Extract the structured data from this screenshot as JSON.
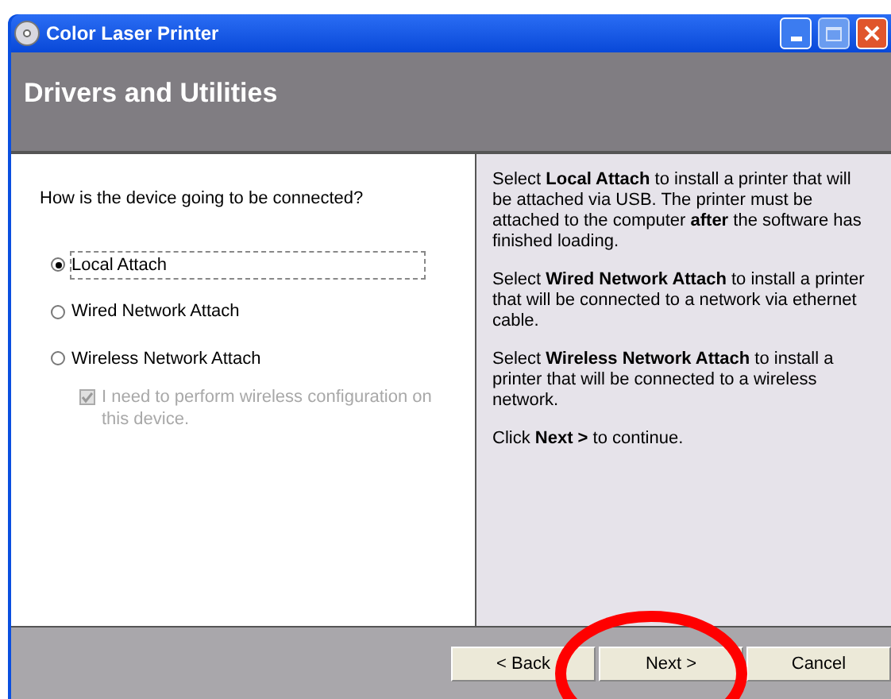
{
  "window": {
    "title": "Color Laser Printer"
  },
  "header": {
    "title": "Drivers and Utilities"
  },
  "question": "How is the device going to be connected?",
  "options": [
    {
      "label": "Local Attach",
      "selected": true,
      "focused": true
    },
    {
      "label": "Wired Network Attach",
      "selected": false,
      "focused": false
    },
    {
      "label": "Wireless Network Attach",
      "selected": false,
      "focused": false
    }
  ],
  "wireless_config": {
    "label": "I need to perform wireless configuration on this device.",
    "checked": true,
    "disabled": true
  },
  "help": [
    "Select **Local Attach** to install a printer that will be attached via USB. The printer must be attached to the computer **after** the software has finished loading.",
    "Select **Wired Network Attach** to install a printer that will be connected to a network via ethernet cable.",
    "Select **Wireless Network Attach** to install a printer that will be connected to a wireless network.",
    "Click **Next >** to continue."
  ],
  "buttons": [
    "< Back",
    "Next >",
    "Cancel"
  ]
}
